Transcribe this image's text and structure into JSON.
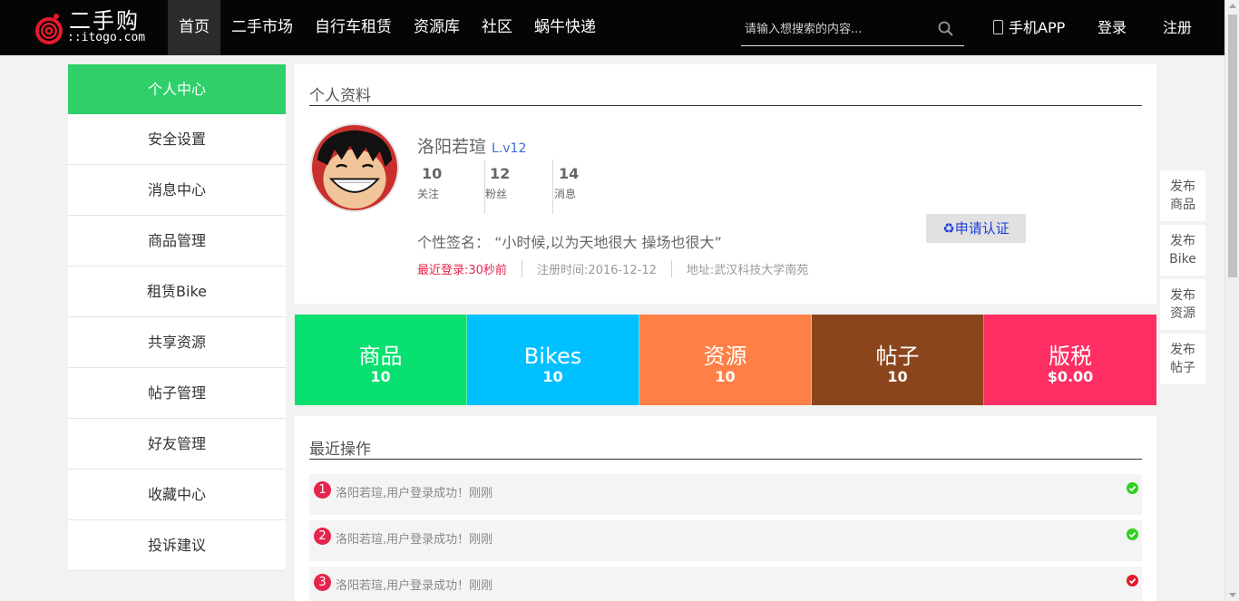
{
  "header": {
    "logo": {
      "title": "二手购",
      "subtitle": "::itogo.com"
    },
    "nav": [
      {
        "label": "首页",
        "active": true
      },
      {
        "label": "二手市场",
        "active": false
      },
      {
        "label": "自行车租赁",
        "active": false
      },
      {
        "label": "资源库",
        "active": false
      },
      {
        "label": "社区",
        "active": false
      },
      {
        "label": "蜗牛快递",
        "active": false
      }
    ],
    "search": {
      "placeholder": "请输入想搜索的内容...",
      "value": ""
    },
    "app_label": "手机APP",
    "login_label": "登录",
    "register_label": "注册"
  },
  "sidebar": {
    "items": [
      {
        "label": "个人中心",
        "active": true
      },
      {
        "label": "安全设置"
      },
      {
        "label": "消息中心"
      },
      {
        "label": "商品管理"
      },
      {
        "label": "租赁Bike"
      },
      {
        "label": "共享资源"
      },
      {
        "label": "帖子管理"
      },
      {
        "label": "好友管理"
      },
      {
        "label": "收藏中心"
      },
      {
        "label": "投诉建议"
      }
    ]
  },
  "profile": {
    "section_title": "个人资料",
    "username": "洛阳若瑄",
    "level": "L.v12",
    "stats": [
      {
        "value": "10",
        "label": "关注"
      },
      {
        "value": "12",
        "label": "粉丝"
      },
      {
        "value": "14",
        "label": "消息"
      }
    ],
    "cert_button": "♻申请认证",
    "signature": "个性签名：  “小时候,以为天地很大 操场也很大”",
    "last_login": "最近登录:30秒前",
    "register_time": "注册时间:2016-12-12",
    "address": "地址:武汉科技大学南苑"
  },
  "tiles": [
    {
      "name": "商品",
      "value": "10",
      "color": "#08e06f"
    },
    {
      "name": "Bikes",
      "value": "10",
      "color": "#00c0ff"
    },
    {
      "name": "资源",
      "value": "10",
      "color": "#fe8046"
    },
    {
      "name": "帖子",
      "value": "10",
      "color": "#8b451c"
    },
    {
      "name": "版税",
      "value": "$0.00",
      "color": "#ff2e63"
    }
  ],
  "recent": {
    "section_title": "最近操作",
    "items": [
      {
        "index": "1",
        "text": "洛阳若瑄,用户登录成功！刚刚",
        "status": "success",
        "status_color": "#2dd11e"
      },
      {
        "index": "2",
        "text": "洛阳若瑄,用户登录成功！刚刚",
        "status": "success",
        "status_color": "#2dd11e"
      },
      {
        "index": "3",
        "text": "洛阳若瑄,用户登录成功！刚刚",
        "status": "error",
        "status_color": "#e11b2a"
      }
    ]
  },
  "float_buttons": [
    {
      "line1": "发布",
      "line2": "商品"
    },
    {
      "line1": "发布",
      "line2": "Bike"
    },
    {
      "line1": "发布",
      "line2": "资源"
    },
    {
      "line1": "发布",
      "line2": "帖子"
    }
  ],
  "colors": {
    "nav_bg": "#050505",
    "sidebar_active": "#2fd06a",
    "badge_red": "#e4254d"
  }
}
